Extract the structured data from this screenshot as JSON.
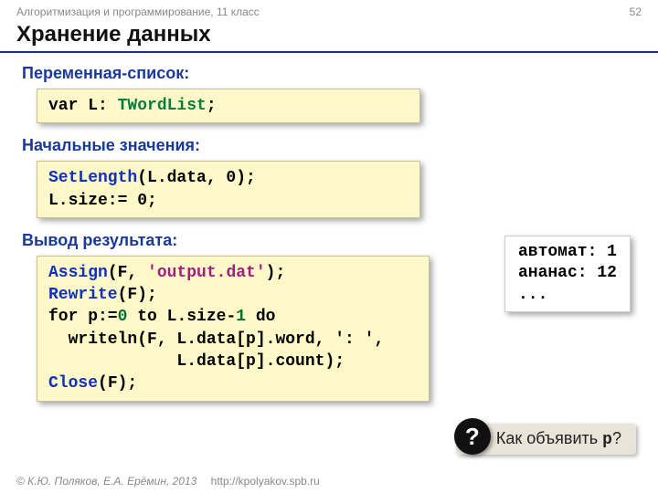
{
  "header": {
    "course": "Алгоритмизация и программирование, 11 класс",
    "page_number": "52"
  },
  "title": "Хранение данных",
  "sections": {
    "var_label": "Переменная-список:",
    "init_label": "Начальные значения:",
    "output_label": "Вывод результата:"
  },
  "code": {
    "var_decl": {
      "pre": "var L: ",
      "type": "TWordList",
      "post": ";"
    },
    "init_line1": {
      "fn": "SetLength",
      "args": "(L.data, 0);"
    },
    "init_line2": "L.size:= 0;",
    "out": {
      "l1a": "Assign",
      "l1b": "(F, ",
      "l1str": "'output.dat'",
      "l1c": ");",
      "l2a": "Rewrite",
      "l2b": "(F);",
      "l3a": "for p:=",
      "l3n0": "0",
      "l3b": " to L.size-",
      "l3n1": "1",
      "l3c": " do",
      "l4": "  writeln(F, L.data[p].word, ': ',",
      "l5": "             L.data[p].count);",
      "l6a": "Close",
      "l6b": "(F);"
    }
  },
  "sample_output": "автомат: 1\nананас: 12\n...",
  "question": {
    "prefix": "Как объявить ",
    "var": "p",
    "suffix": "?"
  },
  "icons": {
    "question_mark": "?"
  },
  "footer": {
    "copyright": "© К.Ю. Поляков, Е.А. Ерёмин, 2013",
    "url": "http://kpolyakov.spb.ru"
  }
}
